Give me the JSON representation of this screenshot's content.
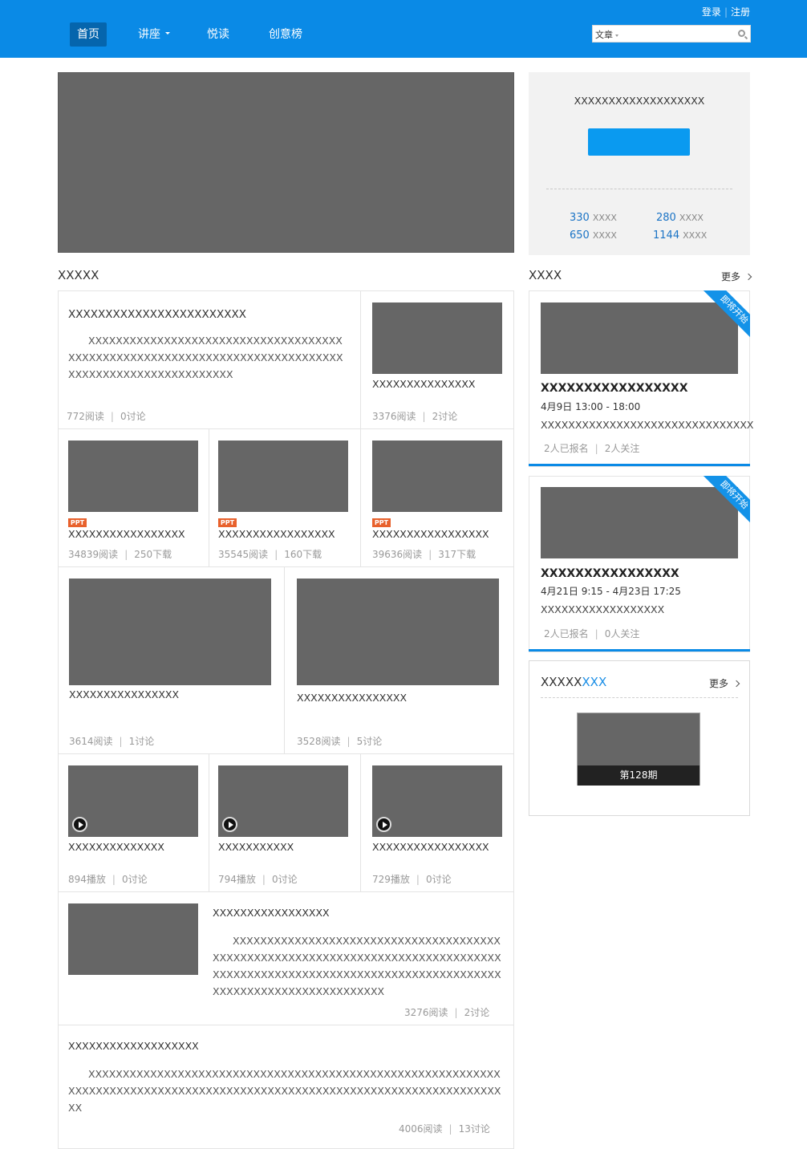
{
  "header": {
    "nav": [
      {
        "label": "首页"
      },
      {
        "label": "讲座"
      },
      {
        "label": "悦读"
      },
      {
        "label": "创意榜"
      }
    ],
    "login": "登录",
    "separator": "|",
    "register": "注册",
    "search": {
      "category": "文章",
      "value": ""
    }
  },
  "user_panel": {
    "title": "XXXXXXXXXXXXXXXXXXX",
    "button_label": "",
    "stats": [
      {
        "value": "330",
        "label": "XXXX"
      },
      {
        "value": "280",
        "label": "XXXX"
      },
      {
        "value": "650",
        "label": "XXXX"
      },
      {
        "value": "1144",
        "label": "XXXX"
      }
    ]
  },
  "left_section": {
    "title": "XXXXX",
    "feature_article": {
      "title": "XXXXXXXXXXXXXXXXXXXXXXXX",
      "body": "XXXXXXXXXXXXXXXXXXXXXXXXXXXXXXXXXXXXXXXXXXXXXXXXXXXXXXXXXXXXXXXXXXXXXXXXXXXXXXXXXXXXXXXXXXXXXXXXXXXXX",
      "reads": "772阅读",
      "comments": "0讨论"
    },
    "side_article": {
      "title": "XXXXXXXXXXXXXXX",
      "reads": "3376阅读",
      "comments": "2讨论"
    },
    "ppt_items": [
      {
        "badge": "PPT",
        "title": "XXXXXXXXXXXXXXXXX",
        "reads": "34839阅读",
        "downloads": "250下载"
      },
      {
        "badge": "PPT",
        "title": "XXXXXXXXXXXXXXXXX",
        "reads": "35545阅读",
        "downloads": "160下载"
      },
      {
        "badge": "PPT",
        "title": "XXXXXXXXXXXXXXXXX",
        "reads": "39636阅读",
        "downloads": "317下载"
      }
    ],
    "large_items": [
      {
        "title": "XXXXXXXXXXXXXXXX",
        "reads": "3614阅读",
        "comments": "1讨论"
      },
      {
        "title": "XXXXXXXXXXXXXXXX",
        "reads": "3528阅读",
        "comments": "5讨论"
      }
    ],
    "video_items": [
      {
        "title": "XXXXXXXXXXXXXX",
        "plays": "894播放",
        "comments": "0讨论"
      },
      {
        "title": "XXXXXXXXXXX",
        "plays": "794播放",
        "comments": "0讨论"
      },
      {
        "title": "XXXXXXXXXXXXXXXXX",
        "plays": "729播放",
        "comments": "0讨论"
      }
    ],
    "media_article": {
      "title": "XXXXXXXXXXXXXXXXX",
      "body": "XXXXXXXXXXXXXXXXXXXXXXXXXXXXXXXXXXXXXXXXXXXXXXXXXXXXXXXXXXXXXXXXXXXXXXXXXXXXXXXXXXXXXXXXXXXXXXXXXXXXXXXXXXXXXXXXXXXXXXXXXXXXXXXXXXXXXXXXXXXXXXXXXXXX",
      "reads": "3276阅读",
      "comments": "2讨论"
    },
    "text_article": {
      "title": "XXXXXXXXXXXXXXXXXXX",
      "body": "XXXXXXXXXXXXXXXXXXXXXXXXXXXXXXXXXXXXXXXXXXXXXXXXXXXXXXXXXXXXXXXXXXXXXXXXXXXXXXXXXXXXXXXXXXXXXXXXXXXXXXXXXXXXXXXXXXXXXXXXXXXXX",
      "reads": "4006阅读",
      "comments": "13讨论"
    }
  },
  "right_section": {
    "title": "XXXX",
    "more": "更多",
    "events": [
      {
        "ribbon": "即将开始",
        "title": "XXXXXXXXXXXXXXXXX",
        "time": "4月9日 13:00 - 18:00",
        "desc": "XXXXXXXXXXXXXXXXXXXXXXXXXXXXXXX",
        "signed": "2人已报名",
        "followers": "2人关注"
      },
      {
        "ribbon": "即将开始",
        "title": "XXXXXXXXXXXXXXXX",
        "time": "4月21日 9:15 - 4月23日 17:25",
        "desc": "XXXXXXXXXXXXXXXXXX",
        "signed": "2人已报名",
        "followers": "0人关注"
      }
    ],
    "issue_box": {
      "title_black": "XXXXX",
      "title_blue": "XXX",
      "more": "更多",
      "issue": "第128期"
    }
  },
  "colors": {
    "brand": "#0a8ae6",
    "placeholder": "#666666"
  }
}
